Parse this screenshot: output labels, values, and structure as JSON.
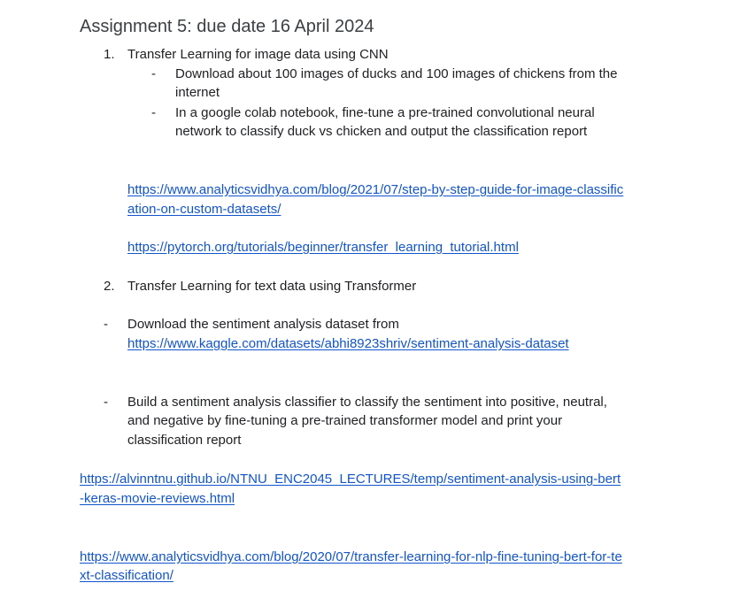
{
  "title": "Assignment 5: due date 16 April 2024",
  "task1": {
    "number": "1.",
    "heading": "Transfer Learning for image data using CNN",
    "bullets": [
      {
        "marker": "-",
        "lines": [
          "Download about 100 images of ducks and 100 images of chickens from the",
          "internet"
        ]
      },
      {
        "marker": "-",
        "lines": [
          "In a google colab notebook, fine-tune a pre-trained convolutional neural",
          "network to classify duck vs chicken and output the classification report"
        ]
      }
    ],
    "links": [
      {
        "lines": [
          "https://www.analyticsvidhya.com/blog/2021/07/step-by-step-guide-for-image-classific",
          "ation-on-custom-datasets/"
        ]
      },
      {
        "lines": [
          "https://pytorch.org/tutorials/beginner/transfer_learning_tutorial.html"
        ]
      }
    ]
  },
  "task2": {
    "number": "2.",
    "heading": "Transfer Learning for text data using Transformer",
    "bullets": [
      {
        "marker": "-",
        "text": "Download the sentiment analysis dataset from",
        "link": "https://www.kaggle.com/datasets/abhi8923shriv/sentiment-analysis-dataset"
      },
      {
        "marker": "-",
        "lines": [
          "Build a sentiment analysis classifier to classify the sentiment into positive, neutral,",
          "and negative by fine-tuning a pre-trained transformer model and print your",
          "classification report"
        ]
      }
    ],
    "links": [
      {
        "lines": [
          "https://alvinntnu.github.io/NTNU_ENC2045_LECTURES/temp/sentiment-analysis-using-bert",
          "-keras-movie-reviews.html"
        ]
      },
      {
        "lines": [
          "https://www.analyticsvidhya.com/blog/2020/07/transfer-learning-for-nlp-fine-tuning-bert-for-te",
          "xt-classification/"
        ]
      }
    ]
  },
  "colors": {
    "text": "#202124",
    "title": "#3c4043",
    "link": "#1155cc",
    "background": "#ffffff"
  }
}
